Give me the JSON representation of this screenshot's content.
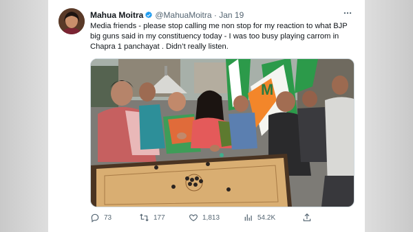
{
  "tweet": {
    "author_name": "Mahua Moitra",
    "handle": "@MahuaMoitra",
    "separator": "·",
    "date": "Jan 19",
    "text": "Media friends - please stop calling me non stop for my reaction to what BJP big guns said in my constituency today - I was too busy playing carrom in Chapra 1 panchayat . Didn’t really listen.",
    "more_icon": "more-horizontal-icon",
    "verified_icon": "verified-badge-icon",
    "flag_letter": "M"
  },
  "actions": {
    "replies": "73",
    "retweets": "177",
    "likes": "1,813",
    "views": "54.2K"
  },
  "colors": {
    "verified_blue": "#1d9bf0",
    "text_primary": "#0f1419",
    "text_secondary": "#536471",
    "flag_green": "#2c9a4a",
    "flag_orange": "#f3862a"
  }
}
